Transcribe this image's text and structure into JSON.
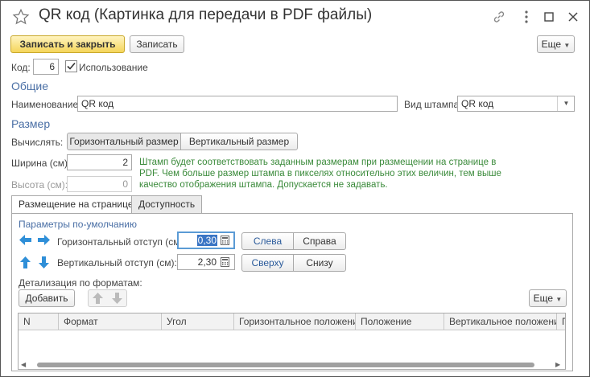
{
  "window": {
    "title": "QR код (Картинка для передачи в PDF файлы)"
  },
  "toolbar": {
    "save_close_label": "Записать и закрыть",
    "save_label": "Записать",
    "more_label": "Еще"
  },
  "code": {
    "label": "Код:",
    "value": "6",
    "usage_label": "Использование",
    "usage_checked": true
  },
  "general": {
    "section_title": "Общие",
    "name_label": "Наименование:",
    "name_value": "QR код",
    "stamp_type_label": "Вид штампа:",
    "stamp_type_value": "QR код"
  },
  "size": {
    "section_title": "Размер",
    "calc_label": "Вычислять:",
    "calc_options": [
      "Горизонтальный размер",
      "Вертикальный размер"
    ],
    "width_label": "Ширина (см):",
    "width_value": "2",
    "height_label": "Высота (см):",
    "height_value": "0",
    "hint": "Штамп будет соответствовать заданным размерам при размещении на странице в PDF. Чем больше размер штампа в пикселях относительно этих величин, тем выше качество отображения штампа. Допускается не задавать."
  },
  "tabs": [
    "Размещение на странице",
    "Доступность"
  ],
  "placement": {
    "defaults_title": "Параметры по-умолчанию",
    "h_offset_label": "Горизонтальный отступ (см):",
    "h_offset_value": "0,30",
    "left_label": "Слева",
    "right_label": "Справа",
    "v_offset_label": "Вертикальный отступ (см):",
    "v_offset_value": "2,30",
    "top_label": "Сверху",
    "bottom_label": "Снизу",
    "formats_title": "Детализация по форматам:",
    "add_label": "Добавить",
    "more_label": "Еще"
  },
  "table": {
    "columns": [
      "N",
      "Формат",
      "Угол",
      "Горизонтальное положение",
      "Положение",
      "Вертикальное положение",
      "П"
    ]
  },
  "colors": {
    "section": "#4a6fa5",
    "hint": "#3a8a3a",
    "primary_button": "#f5d55a",
    "arrow": "#2f8fd8"
  }
}
